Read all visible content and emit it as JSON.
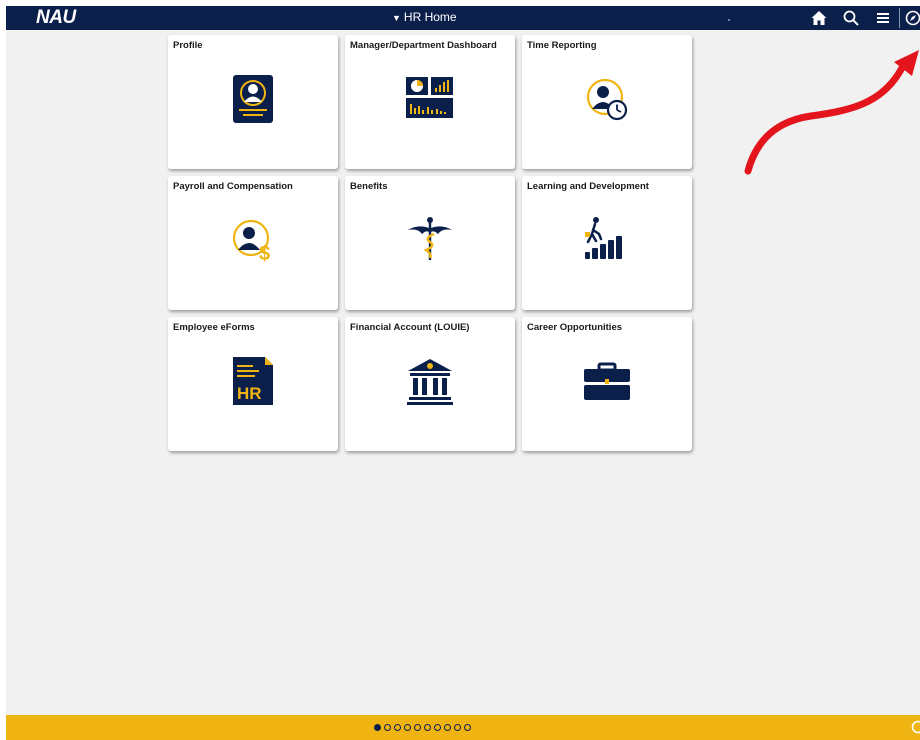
{
  "header": {
    "logo": "NAU",
    "title": "HR Home",
    "icons": [
      "home-icon",
      "search-icon",
      "menu-icon",
      "navbar-icon"
    ]
  },
  "tiles": [
    {
      "label": "Profile",
      "icon": "profile-card-icon"
    },
    {
      "label": "Manager/Department Dashboard",
      "icon": "dashboard-chart-icon"
    },
    {
      "label": "Time Reporting",
      "icon": "person-clock-icon"
    },
    {
      "label": "Payroll and Compensation",
      "icon": "person-dollar-icon"
    },
    {
      "label": "Benefits",
      "icon": "caduceus-icon"
    },
    {
      "label": "Learning and Development",
      "icon": "climbing-steps-icon"
    },
    {
      "label": "Employee eForms",
      "icon": "hr-form-icon"
    },
    {
      "label": "Financial Account (LOUIE)",
      "icon": "bank-icon"
    },
    {
      "label": "Career Opportunities",
      "icon": "briefcase-icon"
    }
  ],
  "footer": {
    "page_dots": 10,
    "active_page": 1
  },
  "colors": {
    "navy": "#0b1f4b",
    "gold": "#f0b412",
    "annotation": "#e3141c"
  }
}
